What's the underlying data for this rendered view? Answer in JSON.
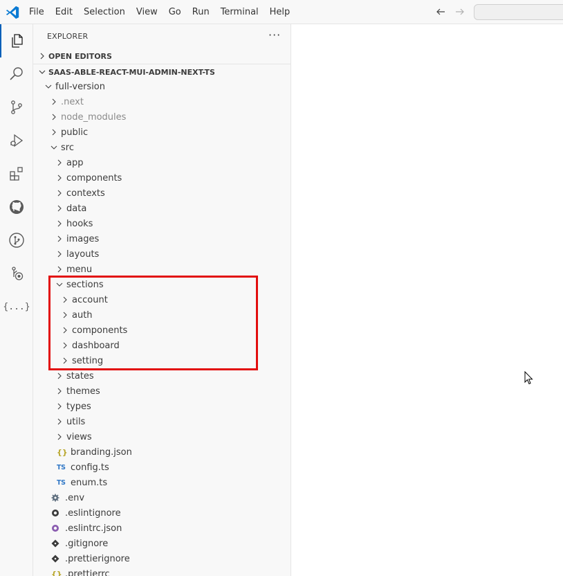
{
  "titlebar": {
    "menu": [
      "File",
      "Edit",
      "Selection",
      "View",
      "Go",
      "Run",
      "Terminal",
      "Help"
    ],
    "icons": [
      "vscode-logo",
      "back-arrow-icon",
      "forward-arrow-icon"
    ]
  },
  "activitybar": {
    "items": [
      "explorer-icon",
      "search-icon",
      "source-control-icon",
      "run-debug-icon",
      "extensions-icon",
      "github-icon",
      "git-graph-icon",
      "remote-explorer-icon",
      "json-icon"
    ],
    "json_label": "{...}"
  },
  "sidebar": {
    "header": "EXPLORER",
    "more": "···",
    "open_editors": "OPEN EDITORS",
    "project": "SAAS-ABLE-REACT-MUI-ADMIN-NEXT-TS"
  },
  "tree": [
    {
      "name": "full-version",
      "depth": 0,
      "type": "folder",
      "open": true
    },
    {
      "name": ".next",
      "depth": 1,
      "type": "folder",
      "open": false,
      "dim": true
    },
    {
      "name": "node_modules",
      "depth": 1,
      "type": "folder",
      "open": false,
      "dim": true
    },
    {
      "name": "public",
      "depth": 1,
      "type": "folder",
      "open": false
    },
    {
      "name": "src",
      "depth": 1,
      "type": "folder",
      "open": true
    },
    {
      "name": "app",
      "depth": 2,
      "type": "folder",
      "open": false
    },
    {
      "name": "components",
      "depth": 2,
      "type": "folder",
      "open": false
    },
    {
      "name": "contexts",
      "depth": 2,
      "type": "folder",
      "open": false
    },
    {
      "name": "data",
      "depth": 2,
      "type": "folder",
      "open": false
    },
    {
      "name": "hooks",
      "depth": 2,
      "type": "folder",
      "open": false
    },
    {
      "name": "images",
      "depth": 2,
      "type": "folder",
      "open": false
    },
    {
      "name": "layouts",
      "depth": 2,
      "type": "folder",
      "open": false
    },
    {
      "name": "menu",
      "depth": 2,
      "type": "folder",
      "open": false
    },
    {
      "name": "sections",
      "depth": 2,
      "type": "folder",
      "open": true
    },
    {
      "name": "account",
      "depth": 3,
      "type": "folder",
      "open": false
    },
    {
      "name": "auth",
      "depth": 3,
      "type": "folder",
      "open": false
    },
    {
      "name": "components",
      "depth": 3,
      "type": "folder",
      "open": false
    },
    {
      "name": "dashboard",
      "depth": 3,
      "type": "folder",
      "open": false
    },
    {
      "name": "setting",
      "depth": 3,
      "type": "folder",
      "open": false
    },
    {
      "name": "states",
      "depth": 2,
      "type": "folder",
      "open": false
    },
    {
      "name": "themes",
      "depth": 2,
      "type": "folder",
      "open": false
    },
    {
      "name": "types",
      "depth": 2,
      "type": "folder",
      "open": false
    },
    {
      "name": "utils",
      "depth": 2,
      "type": "folder",
      "open": false
    },
    {
      "name": "views",
      "depth": 2,
      "type": "folder",
      "open": false
    },
    {
      "name": "branding.json",
      "depth": 2,
      "type": "json"
    },
    {
      "name": "config.ts",
      "depth": 2,
      "type": "ts"
    },
    {
      "name": "enum.ts",
      "depth": 2,
      "type": "ts"
    },
    {
      "name": ".env",
      "depth": 1,
      "type": "gear"
    },
    {
      "name": ".eslintignore",
      "depth": 1,
      "type": "eslintignore"
    },
    {
      "name": ".eslintrc.json",
      "depth": 1,
      "type": "eslintrc"
    },
    {
      "name": ".gitignore",
      "depth": 1,
      "type": "git"
    },
    {
      "name": ".prettierignore",
      "depth": 1,
      "type": "git"
    },
    {
      "name": ".prettierrc",
      "depth": 1,
      "type": "json"
    }
  ],
  "badges": {
    "ts": "TS",
    "json": "{}"
  },
  "colors": {
    "accent": "#005fb8",
    "highlight": "#e20e0e",
    "ts": "#3178c6",
    "json": "#b8a62a",
    "eslint": "#8a5cb0",
    "dim": "#8a8a8a"
  }
}
